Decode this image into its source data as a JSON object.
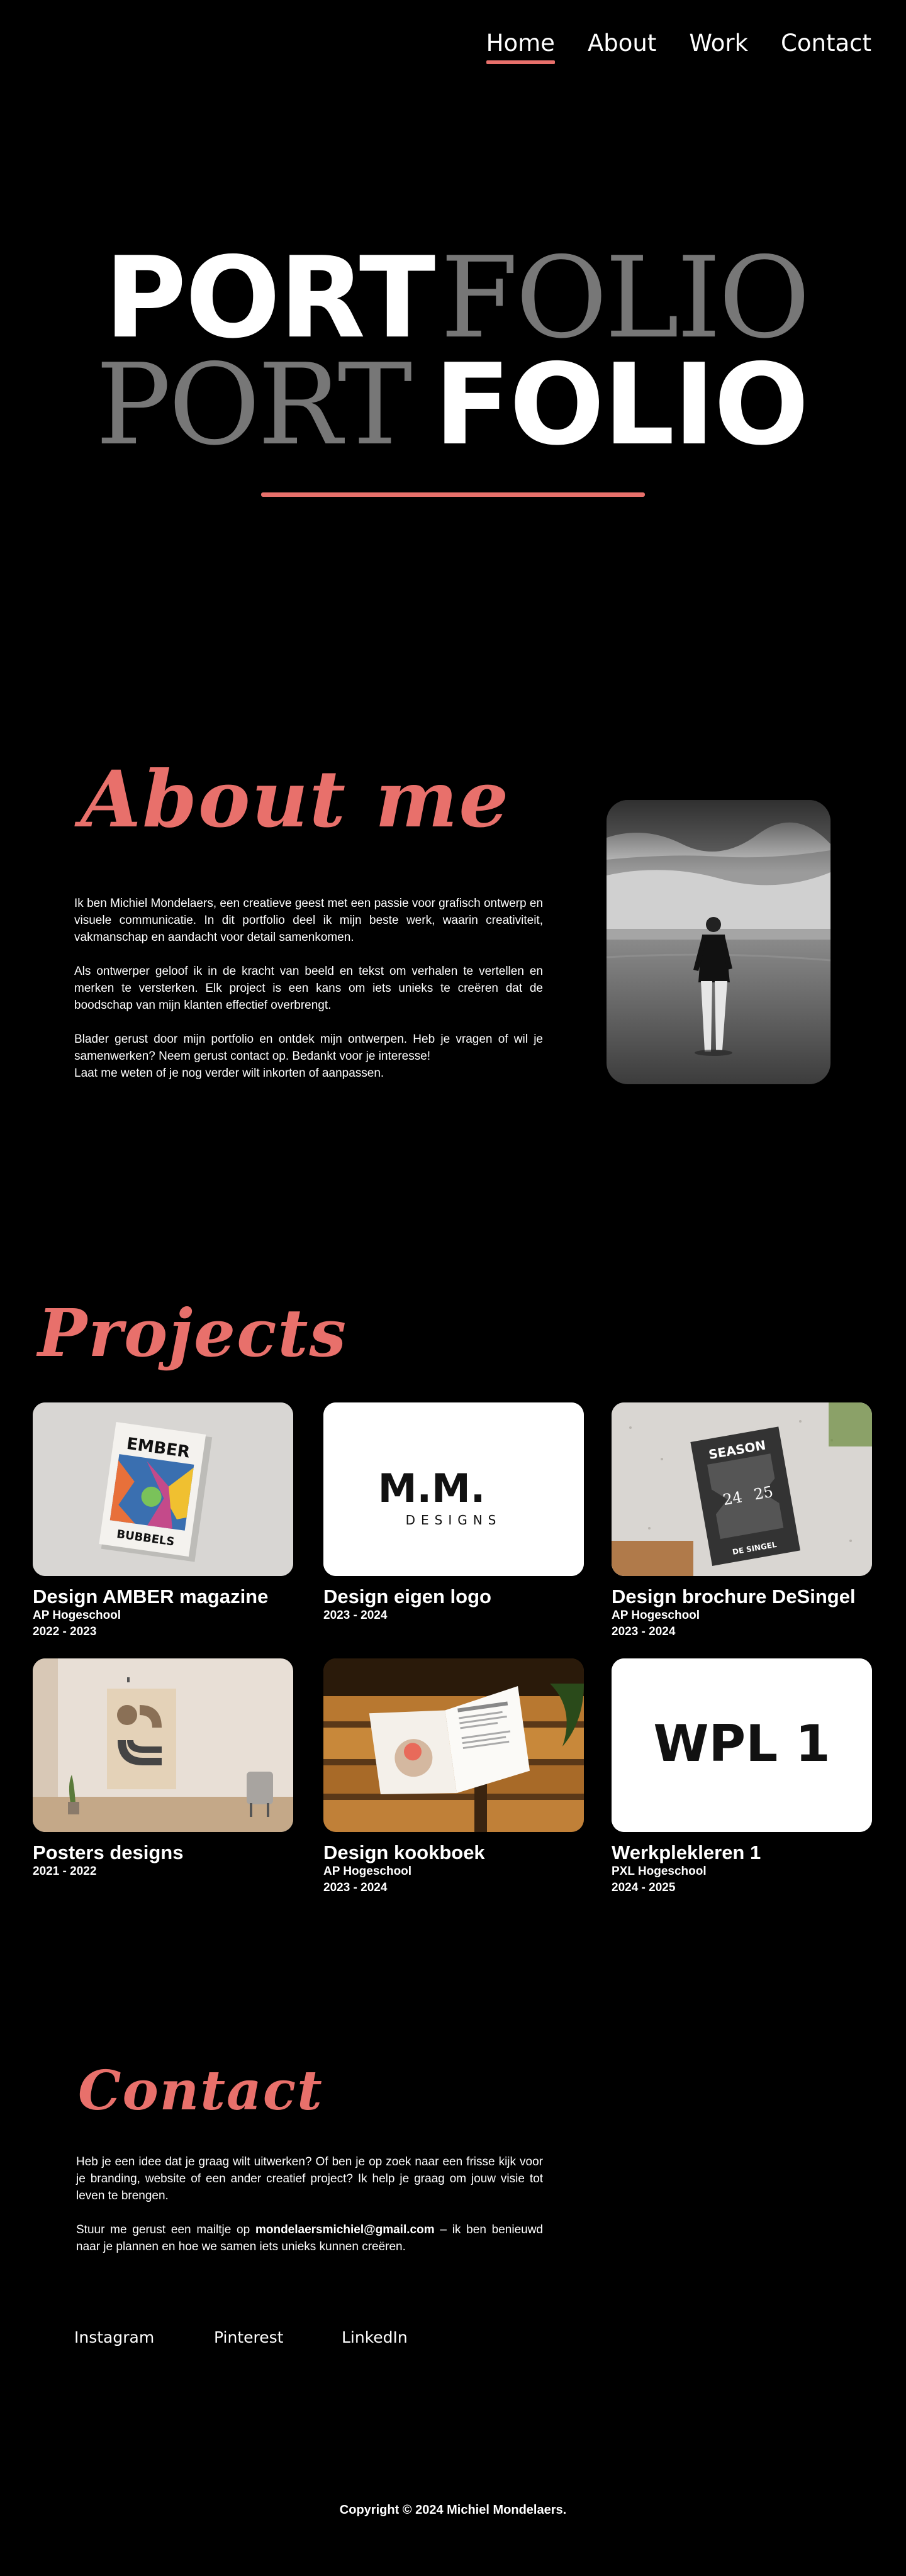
{
  "nav": {
    "items": [
      {
        "label": "Home",
        "active": true
      },
      {
        "label": "About",
        "active": false
      },
      {
        "label": "Work",
        "active": false
      },
      {
        "label": "Contact",
        "active": false
      }
    ]
  },
  "hero": {
    "line1_a": "PORT",
    "line1_b": "FOLIO",
    "line2_a": "PORT",
    "line2_b": "FOLIO",
    "accent_color": "#e8706b"
  },
  "about": {
    "title": "About me",
    "paragraphs": [
      "Ik ben Michiel Mondelaers, een creatieve geest met een passie voor grafisch ontwerp en visuele communicatie. In dit portfolio deel ik mijn beste werk, waarin creativiteit, vakmanschap en aandacht voor detail samenkomen.",
      "Als ontwerper geloof ik in de kracht van beeld en tekst om verhalen te vertellen en merken te versterken. Elk project is een kans om iets unieks te creëren dat de boodschap van mijn klanten effectief overbrengt.",
      "Blader gerust door mijn portfolio en ontdek mijn ontwerpen. Heb je vragen of wil je samenwerken? Neem gerust contact op. Bedankt voor je interesse!",
      "Laat me weten of je nog verder wilt inkorten of aanpassen."
    ]
  },
  "projects": {
    "title": "Projects",
    "items": [
      {
        "title": "Design AMBER magazine",
        "school": "AP Hogeschool",
        "years": "2022 - 2023",
        "thumb_text_1": "EMBER",
        "thumb_text_2": "BUBBELS"
      },
      {
        "title": "Design eigen logo",
        "school": "",
        "years": "2023 - 2024",
        "thumb_text_1": "M.M.",
        "thumb_text_2": "DESIGNS"
      },
      {
        "title": "Design brochure DeSingel",
        "school": "AP Hogeschool",
        "years": "2023 - 2024",
        "thumb_text_1": "SEASON",
        "thumb_text_2": "DE SINGEL",
        "thumb_num_1": "24",
        "thumb_num_2": "25"
      },
      {
        "title": "Posters designs",
        "school": "",
        "years": "2021 - 2022"
      },
      {
        "title": "Design kookboek",
        "school": "AP Hogeschool",
        "years": "2023 - 2024"
      },
      {
        "title": "Werkplekleren 1",
        "school": "PXL Hogeschool",
        "years": "2024 - 2025",
        "thumb_text_1": "WPL 1"
      }
    ]
  },
  "contact": {
    "title": "Contact",
    "paragraph1": "Heb je een idee dat je graag wilt uitwerken? Of ben je op zoek naar een frisse kijk voor je branding, website of een ander creatief project? Ik help je graag om jouw visie tot leven te brengen.",
    "paragraph2_pre": "Stuur me gerust een mailtje op ",
    "email": "mondelaersmichiel@gmail.com",
    "paragraph2_post": " – ik ben benieuwd naar je plannen en hoe we samen iets unieks kunnen creëren."
  },
  "socials": [
    "Instagram",
    "Pinterest",
    "LinkedIn"
  ],
  "footer": "Copyright © 2024 Michiel Mondelaers."
}
